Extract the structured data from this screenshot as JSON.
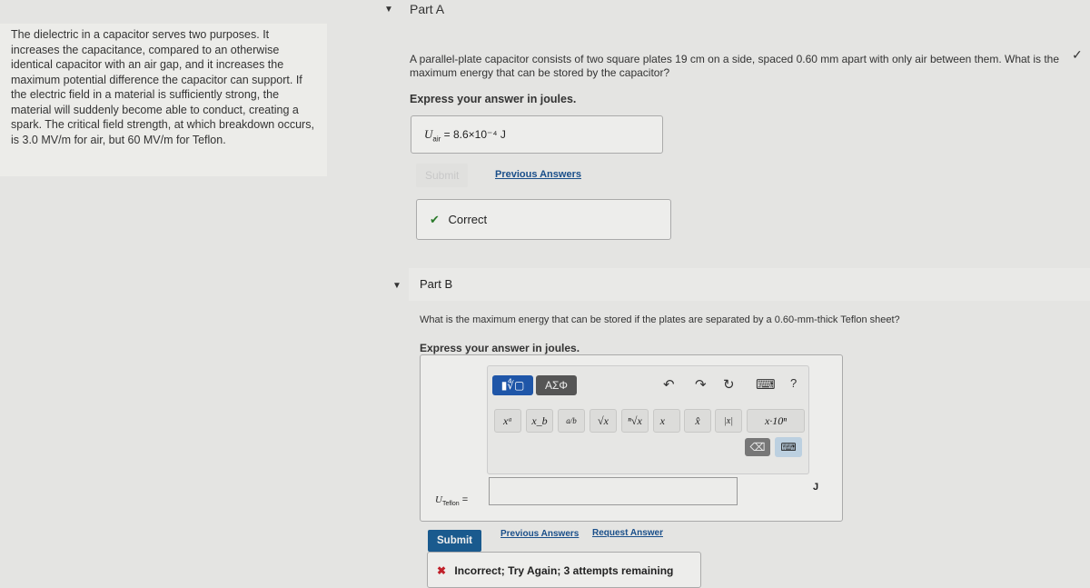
{
  "intro": "The dielectric in a capacitor serves two purposes. It increases the capacitance, compared to an otherwise identical capacitor with an air gap, and it increases the maximum potential difference the capacitor can support. If the electric field in a material is sufficiently strong, the material will suddenly become able to conduct, creating a spark. The critical field strength, at which breakdown occurs, is 3.0 MV/m for air, but 60 MV/m for Teflon.",
  "partA": {
    "title": "Part A",
    "question": "A parallel-plate capacitor consists of two square plates 19 cm on a side, spaced 0.60 mm apart with only air between them. What is the maximum energy that can be stored by the capacitor?",
    "instruction": "Express your answer in joules.",
    "label": "U",
    "sub": "air",
    "answer": "= 8.6×10⁻⁴ J",
    "submit": "Submit",
    "prev": "Previous Answers",
    "feedback": "Correct",
    "check": "✓"
  },
  "partB": {
    "title": "Part B",
    "question": "What is the maximum energy that can be stored if the plates are separated by a 0.60-mm-thick Teflon sheet?",
    "instruction": "Express your answer in joules.",
    "label": "U",
    "sub": "Teflon",
    "eq": "=",
    "unit": "J",
    "value": "",
    "submit": "Submit",
    "prev": "Previous Answers",
    "request": "Request Answer",
    "feedback": "Incorrect; Try Again; 3 attempts remaining",
    "toolbar": {
      "templates": "▮∜▢",
      "greek": "ΑΣΦ",
      "undo": "↶",
      "redo": "↷",
      "reset": "↻",
      "keyboard": "⌨",
      "help": "?",
      "buttons": [
        "xᵃ",
        "x_b",
        "a/b",
        "√x",
        "ⁿ√x",
        "x⃗",
        "x̂",
        "|x|",
        "x·10ⁿ"
      ],
      "backspace": "⌫"
    }
  }
}
